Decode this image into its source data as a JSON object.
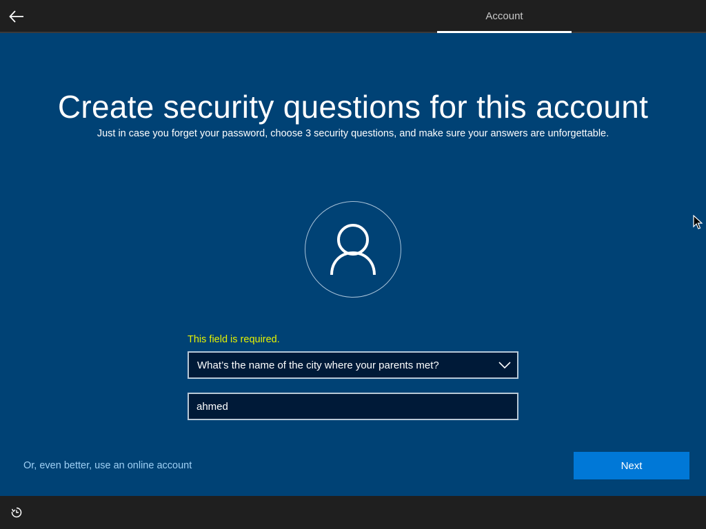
{
  "header": {
    "back_icon": "arrow-left-icon",
    "tab_label": "Account"
  },
  "main": {
    "title": "Create security questions for this account",
    "subtitle": "Just in case you forget your password, choose 3 security questions, and make sure your answers are unforgettable.",
    "avatar_icon": "person-icon",
    "error_text": "This field is required.",
    "question_select": {
      "selected_value": "What’s the name of the city where your parents met?",
      "icon": "chevron-down-icon"
    },
    "answer_field": {
      "value": "ahmed",
      "placeholder": ""
    },
    "online_account_link": "Or, even better, use an online account",
    "next_button": "Next"
  },
  "footer": {
    "ease_of_access_icon": "ease-of-access-icon"
  },
  "colors": {
    "background": "#004275",
    "bars": "#1f1f1f",
    "accent": "#0078d7",
    "error": "#e6f200",
    "link": "#9fd0f5"
  }
}
